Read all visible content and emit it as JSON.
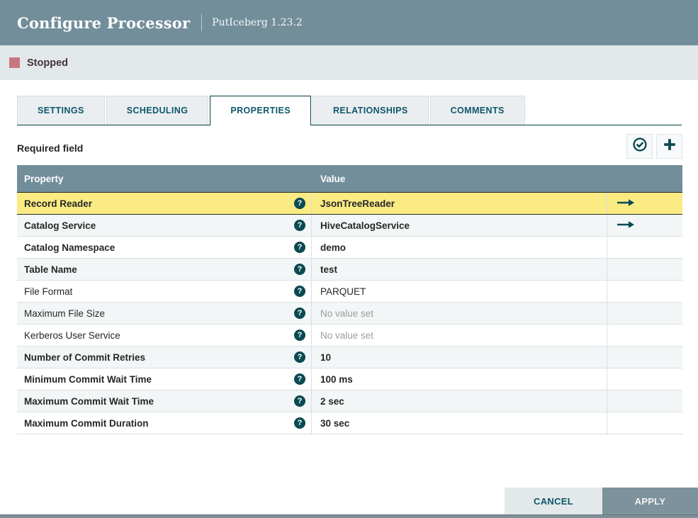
{
  "dialog": {
    "title": "Configure Processor",
    "processor_name": "PutIceberg 1.23.2",
    "status": {
      "label": "Stopped",
      "color": "#C7777D"
    },
    "tabs": [
      {
        "label": "SETTINGS",
        "active": false
      },
      {
        "label": "SCHEDULING",
        "active": false
      },
      {
        "label": "PROPERTIES",
        "active": true
      },
      {
        "label": "RELATIONSHIPS",
        "active": false
      },
      {
        "label": "COMMENTS",
        "active": false
      }
    ],
    "required_field_label": "Required field",
    "toolbar": {
      "verify_icon": "check-circle-icon",
      "add_icon": "plus-icon"
    },
    "table": {
      "columns": [
        "Property",
        "Value"
      ],
      "rows": [
        {
          "property": "Record Reader",
          "value": "JsonTreeReader",
          "required": true,
          "unset": false,
          "has_arrow": true,
          "highlighted": true
        },
        {
          "property": "Catalog Service",
          "value": "HiveCatalogService",
          "required": true,
          "unset": false,
          "has_arrow": true,
          "highlighted": false
        },
        {
          "property": "Catalog Namespace",
          "value": "demo",
          "required": true,
          "unset": false,
          "has_arrow": false,
          "highlighted": false
        },
        {
          "property": "Table Name",
          "value": "test",
          "required": true,
          "unset": false,
          "has_arrow": false,
          "highlighted": false
        },
        {
          "property": "File Format",
          "value": "PARQUET",
          "required": false,
          "unset": false,
          "has_arrow": false,
          "highlighted": false
        },
        {
          "property": "Maximum File Size",
          "value": "No value set",
          "required": false,
          "unset": true,
          "has_arrow": false,
          "highlighted": false
        },
        {
          "property": "Kerberos User Service",
          "value": "No value set",
          "required": false,
          "unset": true,
          "has_arrow": false,
          "highlighted": false
        },
        {
          "property": "Number of Commit Retries",
          "value": "10",
          "required": true,
          "unset": false,
          "has_arrow": false,
          "highlighted": false
        },
        {
          "property": "Minimum Commit Wait Time",
          "value": "100 ms",
          "required": true,
          "unset": false,
          "has_arrow": false,
          "highlighted": false
        },
        {
          "property": "Maximum Commit Wait Time",
          "value": "2 sec",
          "required": true,
          "unset": false,
          "has_arrow": false,
          "highlighted": false
        },
        {
          "property": "Maximum Commit Duration",
          "value": "30 sec",
          "required": true,
          "unset": false,
          "has_arrow": false,
          "highlighted": false
        }
      ]
    },
    "buttons": {
      "cancel": "CANCEL",
      "apply": "APPLY"
    },
    "colors": {
      "header_bg": "#728E9B",
      "status_bar_bg": "#E3E8EA",
      "highlight_row": "#FAEB83",
      "accent_teal": "#0E566B",
      "icon_teal": "#0A4A52"
    }
  }
}
